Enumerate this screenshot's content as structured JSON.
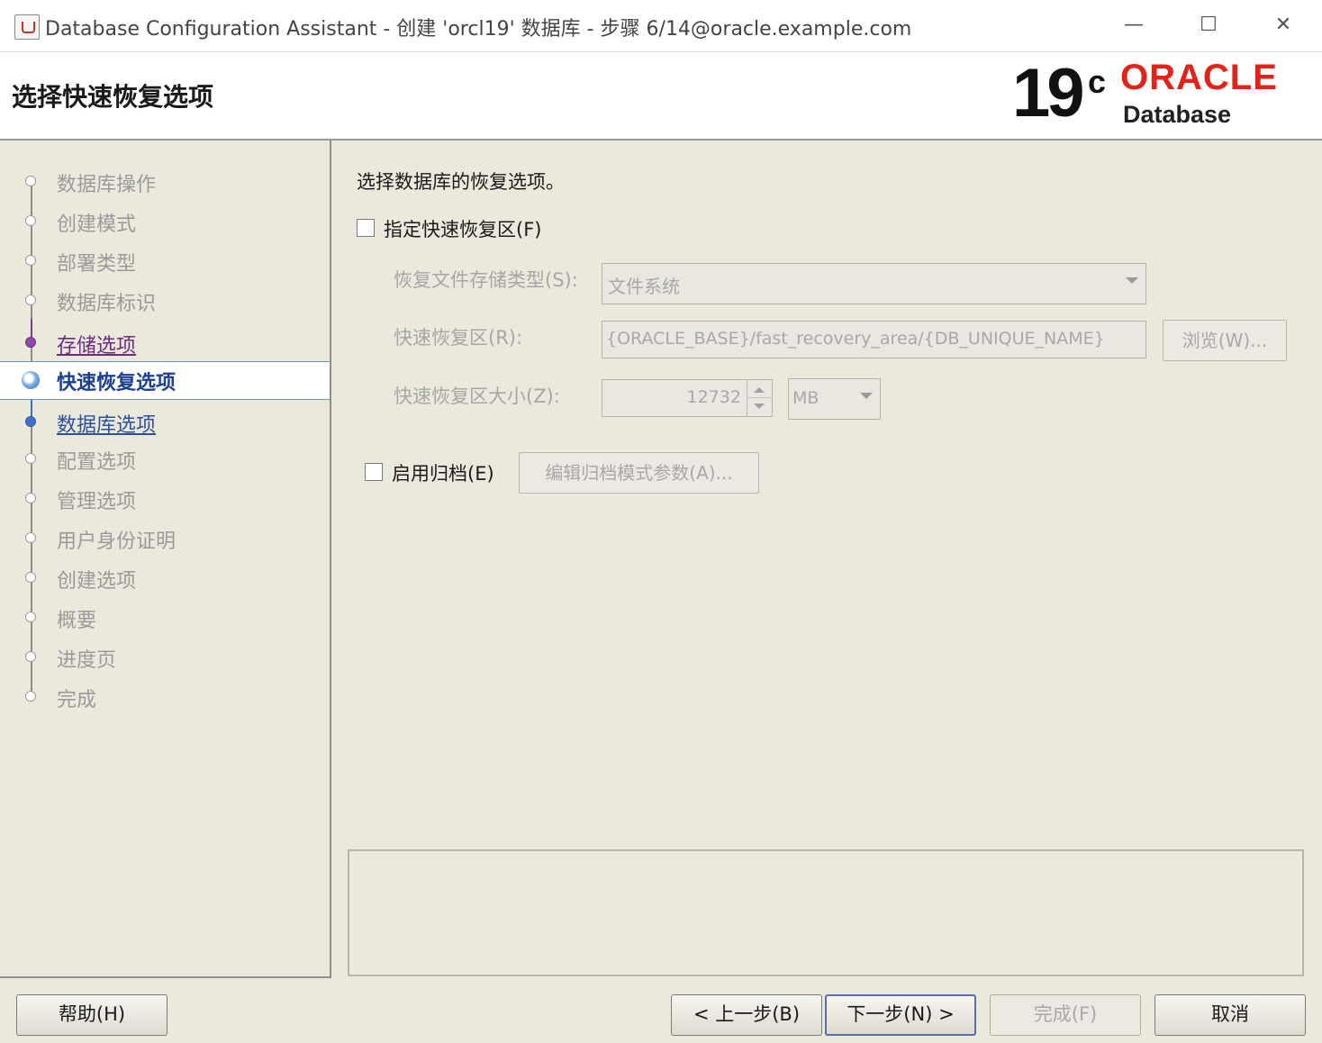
{
  "window": {
    "title": "Database Configuration Assistant - 创建 'orcl19' 数据库 - 步骤 6/14@oracle.example.com",
    "controls": {
      "minimize": "—",
      "maximize": "☐",
      "close": "✕"
    }
  },
  "header": {
    "title": "选择快速恢复选项",
    "logo": {
      "version": "19",
      "version_sup": "c",
      "brand": "ORACLE",
      "product": "Database",
      "brand_color": "#e2231a"
    }
  },
  "nav": {
    "items": [
      {
        "label": "数据库操作",
        "state": "disabled"
      },
      {
        "label": "创建模式",
        "state": "disabled"
      },
      {
        "label": "部署类型",
        "state": "disabled"
      },
      {
        "label": "数据库标识",
        "state": "disabled"
      },
      {
        "label": "存储选项",
        "state": "visited"
      },
      {
        "label": "快速恢复选项",
        "state": "current"
      },
      {
        "label": "数据库选项",
        "state": "next"
      },
      {
        "label": "配置选项",
        "state": "disabled"
      },
      {
        "label": "管理选项",
        "state": "disabled"
      },
      {
        "label": "用户身份证明",
        "state": "disabled"
      },
      {
        "label": "创建选项",
        "state": "disabled"
      },
      {
        "label": "概要",
        "state": "disabled"
      },
      {
        "label": "进度页",
        "state": "disabled"
      },
      {
        "label": "完成",
        "state": "disabled"
      }
    ]
  },
  "main": {
    "intro": "选择数据库的恢复选项。",
    "fra_checkbox": {
      "label": "指定快速恢复区(F)",
      "checked": false
    },
    "storage_type": {
      "label": "恢复文件存储类型(S):",
      "value": "文件系统"
    },
    "fra_location": {
      "label": "快速恢复区(R):",
      "value": "{ORACLE_BASE}/fast_recovery_area/{DB_UNIQUE_NAME}",
      "browse_label": "浏览(W)..."
    },
    "fra_size": {
      "label": "快速恢复区大小(Z):",
      "value": "12732",
      "unit": "MB"
    },
    "archive_checkbox": {
      "label": "启用归档(E)",
      "checked": false
    },
    "archive_params_label": "编辑归档模式参数(A)..."
  },
  "footer": {
    "help": "帮助(H)",
    "back": "< 上一步(B)",
    "next": "下一步(N) >",
    "finish": "完成(F)",
    "cancel": "取消"
  }
}
